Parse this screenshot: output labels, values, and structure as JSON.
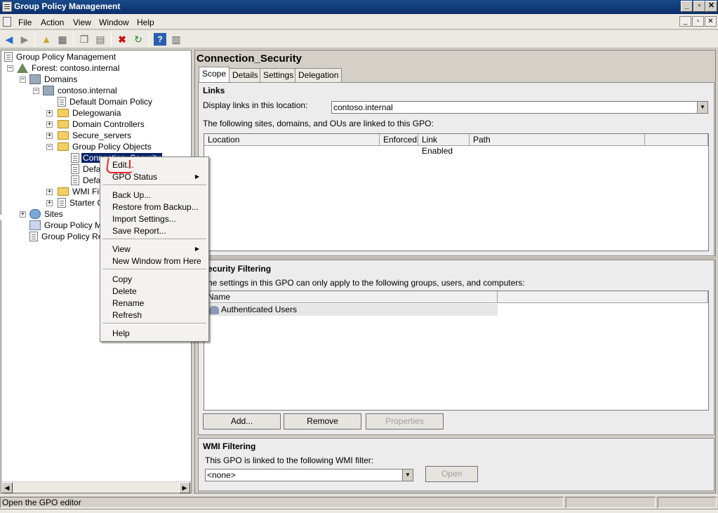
{
  "window": {
    "title": "Group Policy Management"
  },
  "menubar": {
    "items": [
      "File",
      "Action",
      "View",
      "Window",
      "Help"
    ]
  },
  "tree": {
    "root": "Group Policy Management",
    "forest": "Forest: contoso.internal",
    "domains": "Domains",
    "domain": "contoso.internal",
    "default_domain_policy": "Default Domain Policy",
    "delegowania": "Delegowania",
    "domain_controllers": "Domain Controllers",
    "secure_servers": "Secure_servers",
    "gpo_folder": "Group Policy Objects",
    "gpo_selected": "Connection_Security",
    "gpo_2": "Defa",
    "gpo_3": "Defa",
    "wmi_filters": "WMI Filt",
    "starter_gpos": "Starter C",
    "sites": "Sites",
    "modeling": "Group Policy Mod",
    "results": "Group Policy Res"
  },
  "context_menu": {
    "edit": "Edit...",
    "gpo_status": "GPO Status",
    "back_up": "Back Up...",
    "restore": "Restore from Backup...",
    "import": "Import Settings...",
    "save_report": "Save Report...",
    "view": "View",
    "new_window": "New Window from Here",
    "copy": "Copy",
    "delete": "Delete",
    "rename": "Rename",
    "refresh": "Refresh",
    "help": "Help"
  },
  "details": {
    "title": "Connection_Security",
    "tabs": [
      "Scope",
      "Details",
      "Settings",
      "Delegation"
    ],
    "links": {
      "heading": "Links",
      "display_label": "Display links in this location:",
      "display_value": "contoso.internal",
      "desc": "The following sites, domains, and OUs are linked to this GPO:",
      "columns": [
        "Location",
        "Enforced",
        "Link Enabled",
        "Path"
      ]
    },
    "security": {
      "heading": "ecurity Filtering",
      "desc": "he settings in this GPO can only apply to the following groups, users, and computers:",
      "column": "Name",
      "rows": [
        "Authenticated Users"
      ],
      "add": "Add...",
      "remove": "Remove",
      "properties": "Properties"
    },
    "wmi": {
      "heading": "WMI Filtering",
      "desc": "This GPO is linked to the following WMI filter:",
      "value": "<none>",
      "open": "Open"
    }
  },
  "status": {
    "text": "Open the GPO editor"
  }
}
